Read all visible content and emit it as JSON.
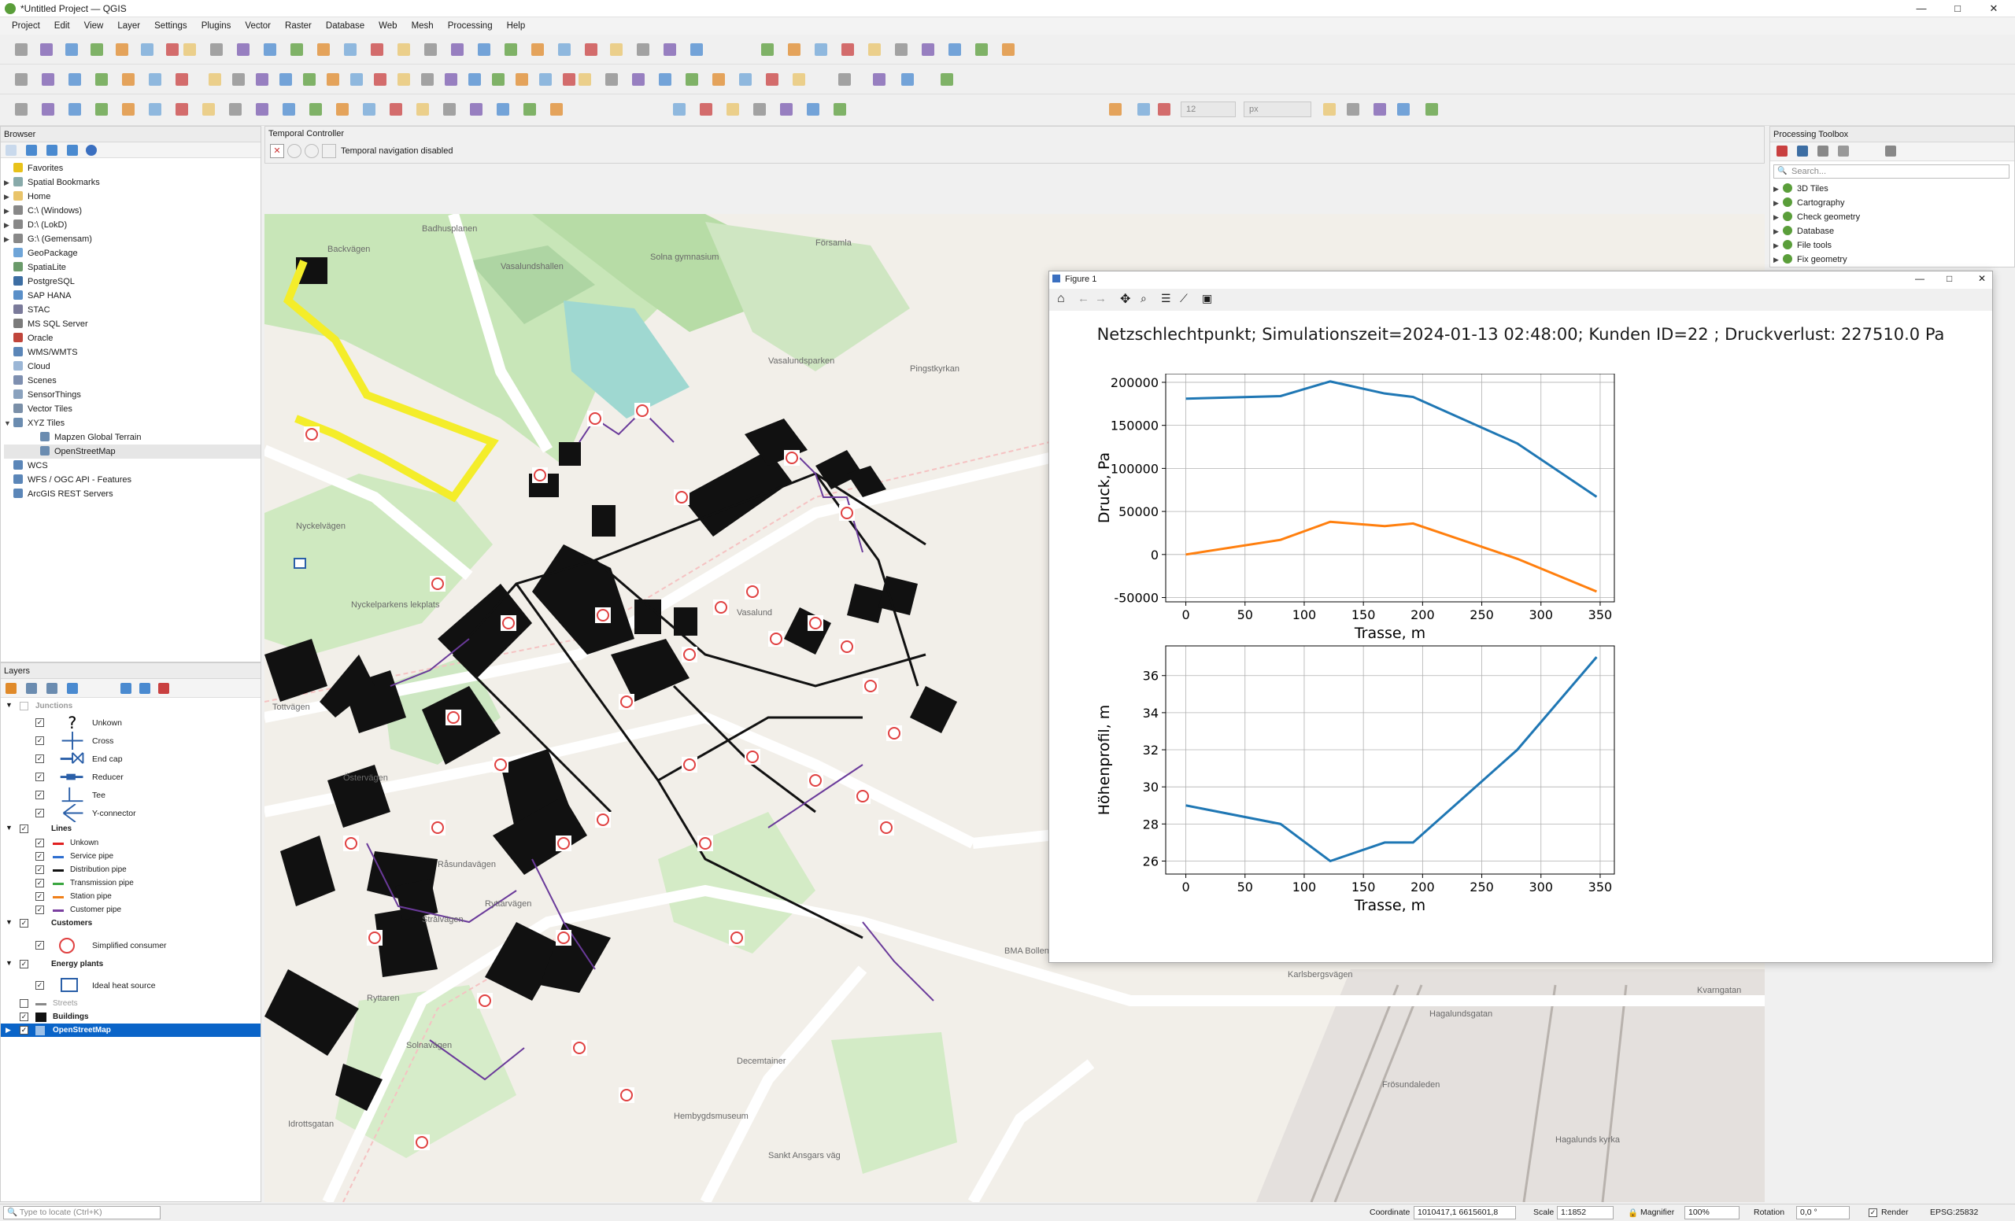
{
  "window": {
    "title": "*Untitled Project — QGIS",
    "minimize": "—",
    "maximize": "□",
    "close": "✕"
  },
  "menu": [
    "Project",
    "Edit",
    "View",
    "Layer",
    "Settings",
    "Plugins",
    "Vector",
    "Raster",
    "Database",
    "Web",
    "Mesh",
    "Processing",
    "Help"
  ],
  "toolbar": {
    "font_size": "12",
    "unit": "px"
  },
  "browser": {
    "title": "Browser",
    "items": [
      {
        "label": "Favorites",
        "icon": "star-icon",
        "color": "#e8c21a",
        "expand": ""
      },
      {
        "label": "Spatial Bookmarks",
        "icon": "bookmark-icon",
        "color": "#8aa",
        "expand": "▶"
      },
      {
        "label": "Home",
        "icon": "folder-icon",
        "color": "#e9c46a",
        "expand": "▶"
      },
      {
        "label": "C:\\ (Windows)",
        "icon": "drive-icon",
        "color": "#888",
        "expand": "▶"
      },
      {
        "label": "D:\\ (LokD)",
        "icon": "drive-icon",
        "color": "#888",
        "expand": "▶"
      },
      {
        "label": "G:\\ (Gemensam)",
        "icon": "drive-icon",
        "color": "#888",
        "expand": "▶"
      },
      {
        "label": "GeoPackage",
        "icon": "geopackage-icon",
        "color": "#6fa5d8",
        "expand": ""
      },
      {
        "label": "SpatiaLite",
        "icon": "spatialite-icon",
        "color": "#6a9a6a",
        "expand": ""
      },
      {
        "label": "PostgreSQL",
        "icon": "postgresql-icon",
        "color": "#3d6ea3",
        "expand": ""
      },
      {
        "label": "SAP HANA",
        "icon": "sap-hana-icon",
        "color": "#5a8fc8",
        "expand": ""
      },
      {
        "label": "STAC",
        "icon": "stac-icon",
        "color": "#7a7a9a",
        "expand": ""
      },
      {
        "label": "MS SQL Server",
        "icon": "mssql-icon",
        "color": "#7b7b7b",
        "expand": ""
      },
      {
        "label": "Oracle",
        "icon": "oracle-icon",
        "color": "#c0453b",
        "expand": ""
      },
      {
        "label": "WMS/WMTS",
        "icon": "wms-icon",
        "color": "#5b86b8",
        "expand": ""
      },
      {
        "label": "Cloud",
        "icon": "cloud-icon",
        "color": "#9bb6d6",
        "expand": ""
      },
      {
        "label": "Scenes",
        "icon": "scenes-icon",
        "color": "#7e8fb0",
        "expand": ""
      },
      {
        "label": "SensorThings",
        "icon": "sensor-icon",
        "color": "#8aa2be",
        "expand": ""
      },
      {
        "label": "Vector Tiles",
        "icon": "vector-tiles-icon",
        "color": "#7a8fa8",
        "expand": ""
      },
      {
        "label": "XYZ Tiles",
        "icon": "xyz-tiles-icon",
        "color": "#6b8cb0",
        "expand": "▼"
      },
      {
        "label": "Mapzen Global Terrain",
        "icon": "grid-icon",
        "color": "#6b8cb0",
        "expand": "",
        "indent": 1
      },
      {
        "label": "OpenStreetMap",
        "icon": "grid-icon",
        "color": "#6b8cb0",
        "expand": "",
        "indent": 1,
        "selected": true
      },
      {
        "label": "WCS",
        "icon": "wcs-icon",
        "color": "#5b86b8",
        "expand": ""
      },
      {
        "label": "WFS / OGC API - Features",
        "icon": "wfs-icon",
        "color": "#5b86b8",
        "expand": ""
      },
      {
        "label": "ArcGIS REST Servers",
        "icon": "arcgis-icon",
        "color": "#5b86b8",
        "expand": ""
      }
    ]
  },
  "layers": {
    "title": "Layers",
    "junctions_group": "Junctions",
    "junctions": [
      {
        "label": "Unkown",
        "sym": "?"
      },
      {
        "label": "Cross",
        "sym": "cross"
      },
      {
        "label": "End cap",
        "sym": "endcap"
      },
      {
        "label": "Reducer",
        "sym": "reducer"
      },
      {
        "label": "Tee",
        "sym": "tee"
      },
      {
        "label": "Y-connector",
        "sym": "y"
      }
    ],
    "lines_group": "Lines",
    "lines": [
      {
        "label": "Unkown",
        "color": "#e02020"
      },
      {
        "label": "Service pipe",
        "color": "#2e6fd0"
      },
      {
        "label": "Distribution pipe",
        "color": "#111111"
      },
      {
        "label": "Transmission pipe",
        "color": "#3aa640"
      },
      {
        "label": "Station pipe",
        "color": "#f0801a"
      },
      {
        "label": "Customer pipe",
        "color": "#7a3fa0"
      }
    ],
    "customers_group": "Customers",
    "customers_item": "Simplified consumer",
    "energy_group": "Energy plants",
    "energy_item": "Ideal heat source",
    "streets": "Streets",
    "buildings": "Buildings",
    "osm": "OpenStreetMap"
  },
  "temporal": {
    "title": "Temporal Controller",
    "status": "Temporal navigation disabled"
  },
  "processing": {
    "title": "Processing Toolbox",
    "search_placeholder": "Search...",
    "items": [
      "3D Tiles",
      "Cartography",
      "Check geometry",
      "Database",
      "File tools",
      "Fix geometry"
    ]
  },
  "figure": {
    "window_title": "Figure 1",
    "title": "Netzschlechtpunkt; Simulationszeit=2024-01-13 02:48:00; Kunden ID=22 ; Druckverlust: 227510.0 Pa"
  },
  "chart_data": [
    {
      "type": "line",
      "xlabel": "Trasse, m",
      "ylabel": "Druck, Pa",
      "xlim": [
        -17,
        362
      ],
      "ylim": [
        -55000,
        210000
      ],
      "xticks": [
        0,
        50,
        100,
        150,
        200,
        250,
        300,
        350
      ],
      "yticks": [
        -50000,
        0,
        50000,
        100000,
        150000,
        200000
      ],
      "grid": true,
      "series": [
        {
          "color": "#1f77b4",
          "x": [
            0,
            80,
            122,
            168,
            192,
            280,
            347
          ],
          "y": [
            181000,
            184000,
            201000,
            187000,
            183000,
            129000,
            67000
          ]
        },
        {
          "color": "#ff7f0e",
          "x": [
            0,
            80,
            122,
            168,
            192,
            280,
            347
          ],
          "y": [
            0,
            17000,
            38000,
            33000,
            36000,
            -5000,
            -43000
          ]
        }
      ]
    },
    {
      "type": "line",
      "xlabel": "Trasse, m",
      "ylabel": "Höhenprofil, m",
      "xlim": [
        -17,
        362
      ],
      "ylim": [
        25.3,
        37.6
      ],
      "xticks": [
        0,
        50,
        100,
        150,
        200,
        250,
        300,
        350
      ],
      "yticks": [
        26,
        28,
        30,
        32,
        34,
        36
      ],
      "grid": true,
      "series": [
        {
          "color": "#1f77b4",
          "x": [
            0,
            80,
            122,
            168,
            192,
            280,
            347
          ],
          "y": [
            29,
            28,
            26,
            27,
            27,
            32,
            37
          ]
        }
      ]
    }
  ],
  "map": {
    "labels": [
      "Backvägen",
      "Badhusplanen",
      "Vasalundshallen",
      "Solna gymnasium",
      "Församla",
      "Pingstkyrkan",
      "Vasalundsparken",
      "Nyckelvägen",
      "Nyckelparkens lekplats",
      "Tottvägen",
      "Östervägen",
      "Råsundavägen",
      "Ryttarvägen",
      "Ryttaren",
      "Solnavägen",
      "Idrottsgatan",
      "Vasalund",
      "BMA Bollen",
      "Decemtainer",
      "Hembygdsmuseum",
      "Sankt Ansgars väg",
      "Hagalundsgatan",
      "Hagalunds kyrka",
      "Frösundaleden",
      "Kvarngatan",
      "Karlsbergsvägen",
      "Strålvägen"
    ]
  },
  "status": {
    "locate_placeholder": "Type to locate (Ctrl+K)",
    "coordinate_label": "Coordinate",
    "coordinate": "1010417,1  6615601,8",
    "scale_label": "Scale",
    "scale": "1:1852",
    "magnifier_label": "Magnifier",
    "magnifier": "100%",
    "rotation_label": "Rotation",
    "rotation": "0,0 °",
    "render_label": "Render",
    "crs": "EPSG:25832"
  }
}
